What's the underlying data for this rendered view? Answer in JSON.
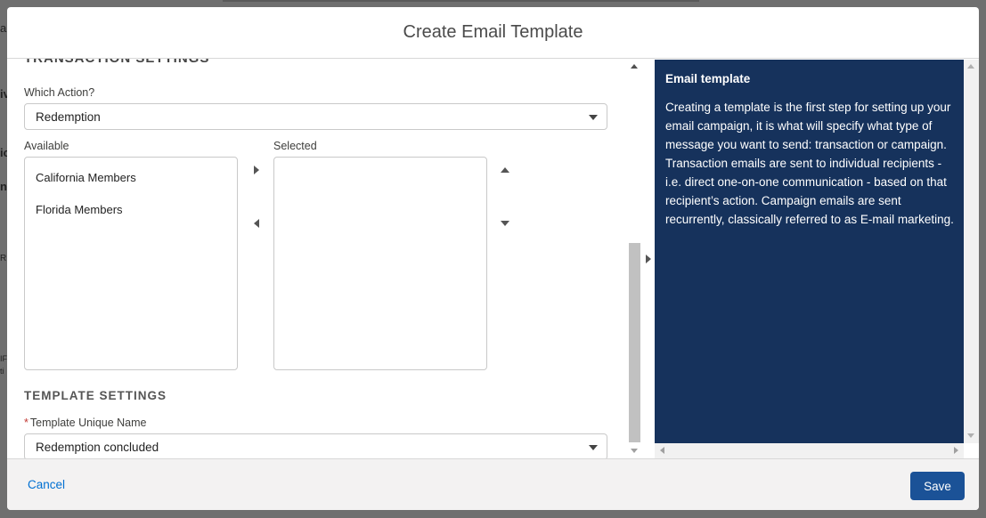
{
  "modal": {
    "title": "Create Email Template"
  },
  "transaction": {
    "section_title_cut": "TRANSACTION SETTINGS",
    "which_action_label": "Which Action?",
    "which_action_value": "Redemption",
    "available_label": "Available",
    "selected_label": "Selected",
    "available_options": [
      "California Members",
      "Florida Members"
    ],
    "selected_options": []
  },
  "template": {
    "section_title": "TEMPLATE SETTINGS",
    "unique_name_required": "*",
    "unique_name_label": "Template Unique Name",
    "unique_name_value": "Redemption concluded"
  },
  "help_panel": {
    "title": "Email template",
    "text": "Creating a template is the first step for setting up your email campaign, it is what will specify what type of message you want to send: transaction or campaign. Transaction emails are sent to individual recipients - i.e. direct one-on-one communication - based on that recipient’s action. Campaign emails are sent recurrently, classically referred to as E-mail marketing.",
    "background": "#16325c"
  },
  "footer": {
    "cancel_label": "Cancel",
    "save_label": "Save",
    "save_color": "#1b5297"
  },
  "background_fragments": [
    "a",
    "ic",
    "iv",
    "nd",
    "R",
    "IF",
    "ti"
  ]
}
